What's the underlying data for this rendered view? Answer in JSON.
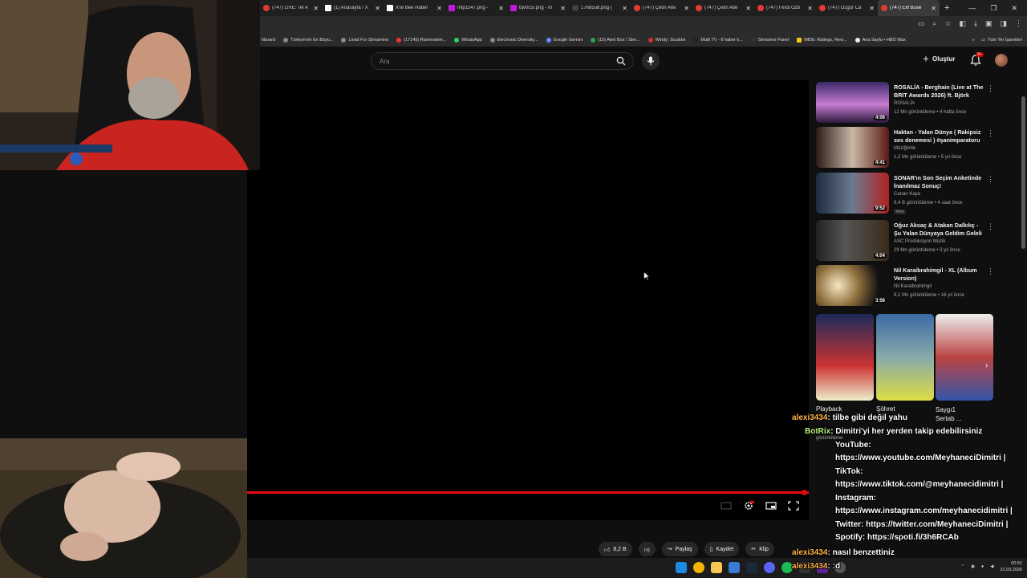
{
  "browser": {
    "tabs": [
      {
        "label": "(747) LIVE: Tel A"
      },
      {
        "label": "(1) Anasayfa / X"
      },
      {
        "label": "X'te Bee Haber"
      },
      {
        "label": "mlp1547.png -"
      },
      {
        "label": "tqv0c5i.png - In"
      },
      {
        "label": "17685u8.png ("
      },
      {
        "label": "(747) Çetin Alte"
      },
      {
        "label": "(747) Çetin Alte"
      },
      {
        "label": "(747) Ferdi Özb"
      },
      {
        "label": "(747) Özgür Ca"
      },
      {
        "label": "(747) Elif Buse"
      }
    ],
    "new_tab": "+",
    "bookmarks": [
      "hboard",
      "Türkiye'nin En Büyü...",
      "Livad For Streamers",
      "(17145) Rammstein...",
      "WhatsApp",
      "Electronic Diversity...",
      "Google Gemini",
      "(19) Alert Box / Stre...",
      "Windy: Sıcaklık",
      "Multi TV - 6 haber k...",
      "Streamer Panel",
      "IMDb: Ratings, Revi...",
      "Ana Sayfa • HBO Max"
    ],
    "bookmarks_more": "»",
    "all_bookmarks": "Tüm Yer İşaretleri"
  },
  "youtube": {
    "search_placeholder": "Ara",
    "create_label": "Oluştur",
    "notif_count": "9+",
    "actions": {
      "like_count": "8,2 B",
      "share": "Paylaş",
      "save": "Kaydet",
      "clip": "Klip"
    },
    "recommendations": [
      {
        "title": "ROSALÍA - Berghain (Live at The BRIT Awards 2026) ft. Björk",
        "channel": "ROSALÍA",
        "meta": "12 Mn görüntüleme • 4 hafta önce",
        "duration": "4:06"
      },
      {
        "title": "Haktan - Yalan Dünya ( Rakipsiz ses denemesi ) #şanimparatoru",
        "channel": "Müziğimle",
        "meta": "1,2 Mn görüntüleme • 5 yıl önce",
        "duration": "4:41"
      },
      {
        "title": "SONAR'ın Son Seçim Anketinde İnanılmaz Sonuç!",
        "channel": "Canan Kaya",
        "meta": "9,4 B görüntüleme • 4 saat önce",
        "duration": "9:52",
        "new": "Yeni"
      },
      {
        "title": "Oğuz Aksaç & Atakan Dalkılıç - Şu Yalan Dünyaya Geldim Geleli",
        "channel": "ASC Prodüksiyon Müzik",
        "meta": "29 Mn görüntüleme • 3 yıl önce",
        "duration": "4:04"
      },
      {
        "title": "Nil Karaibrahimgil - XL (Album Version)",
        "channel": "Nil Karaibrahimgil",
        "meta": "8,1 Mn görüntüleme • 16 yıl önce",
        "duration": "3:56"
      }
    ],
    "shorts": [
      {
        "title": "Playback"
      },
      {
        "title": "Şöhret"
      },
      {
        "title": "Saygı1 Sertab ..."
      }
    ],
    "shorts_sub": "görüntüleme"
  },
  "chat": [
    {
      "user": "alexi3434",
      "text": ": tilbe gibi değil yahu"
    },
    {
      "user": "BotRix",
      "text": ": Dimitri'yi her yerden takip edebilirsiniz"
    },
    {
      "user": "",
      "text": "YouTube:"
    },
    {
      "user": "",
      "text": "https://www.youtube.com/MeyhaneciDimitri |"
    },
    {
      "user": "",
      "text": "TikTok:"
    },
    {
      "user": "",
      "text": "https://www.tiktok.com/@meyhanecidimitri |"
    },
    {
      "user": "",
      "text": "Instagram:"
    },
    {
      "user": "",
      "text": "https://www.instagram.com/meyhanecidimitri |"
    },
    {
      "user": "",
      "text": "Twitter: https://twitter.com/MeyhaneciDimitri |"
    },
    {
      "user": "",
      "text": "Spotify: https://spoti.fi/3h6RCAb"
    },
    {
      "user": "alexi3434",
      "text": ": nasıl benzettiniz"
    },
    {
      "user": "alexi3434",
      "text": ": :d"
    }
  ],
  "taskbar": {
    "time": "00:51",
    "date": "31.03.2026"
  }
}
